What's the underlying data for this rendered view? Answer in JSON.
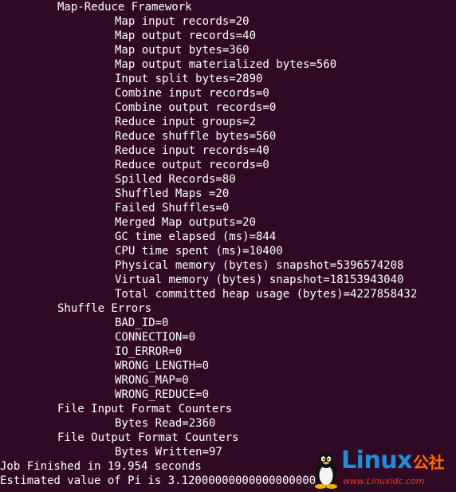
{
  "terminal": {
    "lines": [
      {
        "indent": 1,
        "text": "Map-Reduce Framework"
      },
      {
        "indent": 2,
        "text": "Map input records=20"
      },
      {
        "indent": 2,
        "text": "Map output records=40"
      },
      {
        "indent": 2,
        "text": "Map output bytes=360"
      },
      {
        "indent": 2,
        "text": "Map output materialized bytes=560"
      },
      {
        "indent": 2,
        "text": "Input split bytes=2890"
      },
      {
        "indent": 2,
        "text": "Combine input records=0"
      },
      {
        "indent": 2,
        "text": "Combine output records=0"
      },
      {
        "indent": 2,
        "text": "Reduce input groups=2"
      },
      {
        "indent": 2,
        "text": "Reduce shuffle bytes=560"
      },
      {
        "indent": 2,
        "text": "Reduce input records=40"
      },
      {
        "indent": 2,
        "text": "Reduce output records=0"
      },
      {
        "indent": 2,
        "text": "Spilled Records=80"
      },
      {
        "indent": 2,
        "text": "Shuffled Maps =20"
      },
      {
        "indent": 2,
        "text": "Failed Shuffles=0"
      },
      {
        "indent": 2,
        "text": "Merged Map outputs=20"
      },
      {
        "indent": 2,
        "text": "GC time elapsed (ms)=844"
      },
      {
        "indent": 2,
        "text": "CPU time spent (ms)=10400"
      },
      {
        "indent": 2,
        "text": "Physical memory (bytes) snapshot=5396574208"
      },
      {
        "indent": 2,
        "text": "Virtual memory (bytes) snapshot=18153943040"
      },
      {
        "indent": 2,
        "text": "Total committed heap usage (bytes)=4227858432"
      },
      {
        "indent": 1,
        "text": "Shuffle Errors"
      },
      {
        "indent": 2,
        "text": "BAD_ID=0"
      },
      {
        "indent": 2,
        "text": "CONNECTION=0"
      },
      {
        "indent": 2,
        "text": "IO_ERROR=0"
      },
      {
        "indent": 2,
        "text": "WRONG_LENGTH=0"
      },
      {
        "indent": 2,
        "text": "WRONG_MAP=0"
      },
      {
        "indent": 2,
        "text": "WRONG_REDUCE=0"
      },
      {
        "indent": 1,
        "text": "File Input Format Counters"
      },
      {
        "indent": 2,
        "text": "Bytes Read=2360"
      },
      {
        "indent": 1,
        "text": "File Output Format Counters"
      },
      {
        "indent": 2,
        "text": "Bytes Written=97"
      },
      {
        "indent": 0,
        "text": "Job Finished in 19.954 seconds"
      },
      {
        "indent": 0,
        "text": "Estimated value of Pi is 3.12000000000000000000"
      }
    ]
  },
  "watermark": {
    "brand": "Linux",
    "brand_suffix": "公社",
    "site": "www.Linuxidc.com"
  },
  "colors": {
    "background": "#300a24",
    "text": "#ffffff",
    "brand_blue": "#1e90d6",
    "brand_orange": "#ff6a00",
    "site_red": "#e23a2e"
  }
}
